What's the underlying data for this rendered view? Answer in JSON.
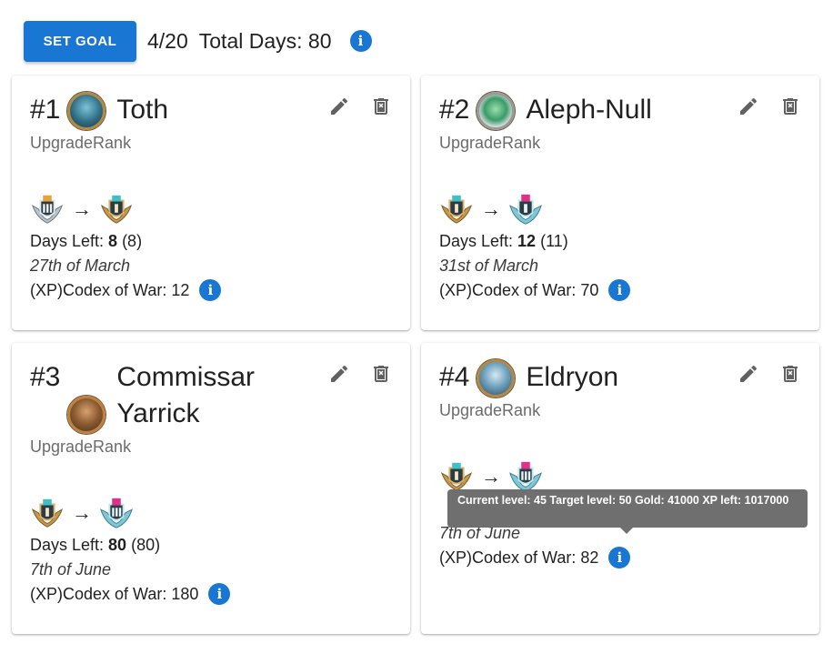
{
  "toolbar": {
    "set_goal_label": "SET GOAL",
    "progress": "4/20",
    "total_days": "Total Days: 80",
    "info_glyph": "i"
  },
  "colors": {
    "accent": "#1976d2",
    "tooltip_bg": "#6f6f6f"
  },
  "icons": {
    "edit": "pencil-icon",
    "delete": "trash-icon",
    "info": "info-icon",
    "arrow": "arrow-right-icon"
  },
  "goals": [
    {
      "rank": "#1",
      "name": "Toth",
      "type": "UpgradeRank",
      "arrow": "→",
      "days_left_label": "Days Left:",
      "days_left": "8",
      "days_left_alt": "(8)",
      "date": "27th of March",
      "xp_line": "(XP)Codex of War: 12"
    },
    {
      "rank": "#2",
      "name": "Aleph-Null",
      "type": "UpgradeRank",
      "arrow": "→",
      "days_left_label": "Days Left:",
      "days_left": "12",
      "days_left_alt": "(11)",
      "date": "31st of March",
      "xp_line": "(XP)Codex of War: 70"
    },
    {
      "rank": "#3",
      "name_line1": "Commissar",
      "name_line2": "Yarrick",
      "type": "UpgradeRank",
      "arrow": "→",
      "days_left_label": "Days Left:",
      "days_left": "80",
      "days_left_alt": "(80)",
      "date": "7th of June",
      "xp_line": "(XP)Codex of War: 180"
    },
    {
      "rank": "#4",
      "name": "Eldryon",
      "type": "UpgradeRank",
      "arrow": "→",
      "date": "7th of June",
      "xp_line": "(XP)Codex of War: 82"
    }
  ],
  "tooltip": {
    "text": "Current level: 45 Target level: 50 Gold: 41000 XP left: 1017000"
  }
}
